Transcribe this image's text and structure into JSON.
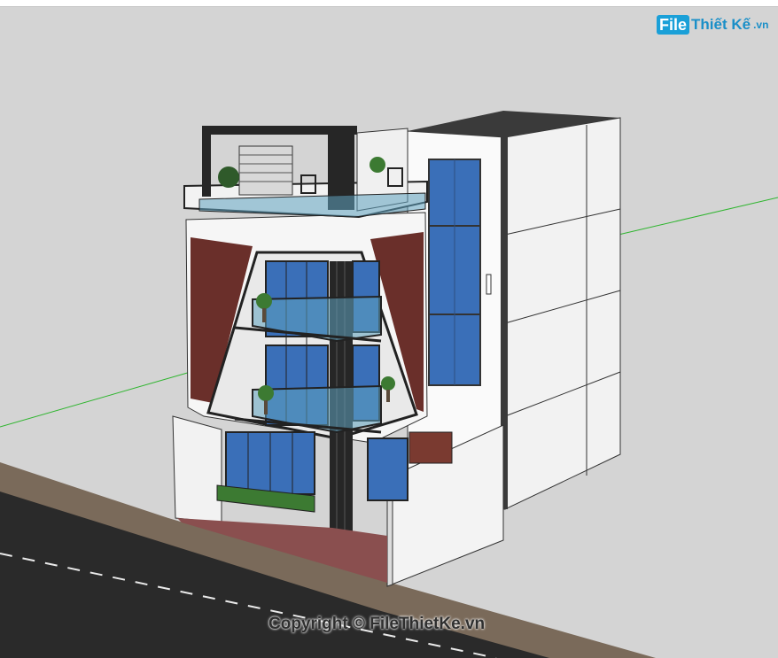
{
  "watermark": {
    "logo_file": "File",
    "logo_rest": "Thiết Kế",
    "logo_suffix": ".vn",
    "copyright": "Copyright © FileThietKe.vn"
  },
  "colors": {
    "background": "#d4d4d4",
    "axis_green": "#2fb52f",
    "road": "#2a2a2a",
    "sidewalk": "#7a6a5a",
    "wall": "#f4f4f4",
    "glass": "#3a6fb8",
    "brick": "#6a2f2a",
    "dark_frame": "#262626",
    "terrace_floor": "#8a4f4f",
    "brand": "#1a8fc8"
  },
  "icons": {
    "plants": "plant-icon",
    "chairs": "chair-icon"
  }
}
